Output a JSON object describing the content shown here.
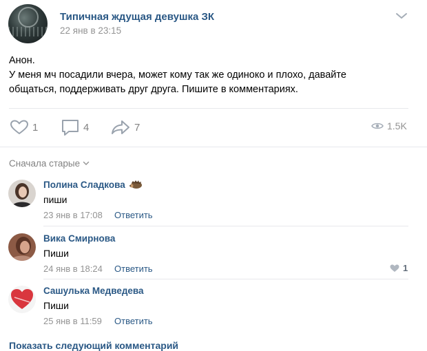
{
  "post": {
    "group_name": "Типичная ждущая девушка ЗК",
    "date": "22 янв в 23:15",
    "text_lines": [
      "Анон.",
      "У меня мч посадили вчера, может кому так же одиноко и плохо, давайте",
      "общаться, поддерживать друг друга. Пишите в комментариях."
    ],
    "likes": "1",
    "comments": "4",
    "shares": "7",
    "views": "1.5K"
  },
  "comments_section": {
    "sort_label": "Сначала старые",
    "items": [
      {
        "author": "Полина Сладкова",
        "text": "пиши",
        "date": "23 янв в 17:08",
        "reply_label": "Ответить"
      },
      {
        "author": "Вика Смирнова",
        "text": "Пиши",
        "date": "24 янв в 18:24",
        "reply_label": "Ответить",
        "likes": "1"
      },
      {
        "author": "Сашулька Медведева",
        "text": "Пиши",
        "date": "25 янв в 11:59",
        "reply_label": "Ответить"
      }
    ],
    "show_next_label": "Показать следующий комментарий"
  },
  "colors": {
    "link": "#2a5885",
    "meta": "#939393",
    "icon": "#99a2ad",
    "divider": "#e7e8ec"
  },
  "icons": [
    "heart-icon",
    "comment-icon",
    "share-icon",
    "eye-icon",
    "chevron-down-icon",
    "hedgehog-emoji-icon"
  ]
}
